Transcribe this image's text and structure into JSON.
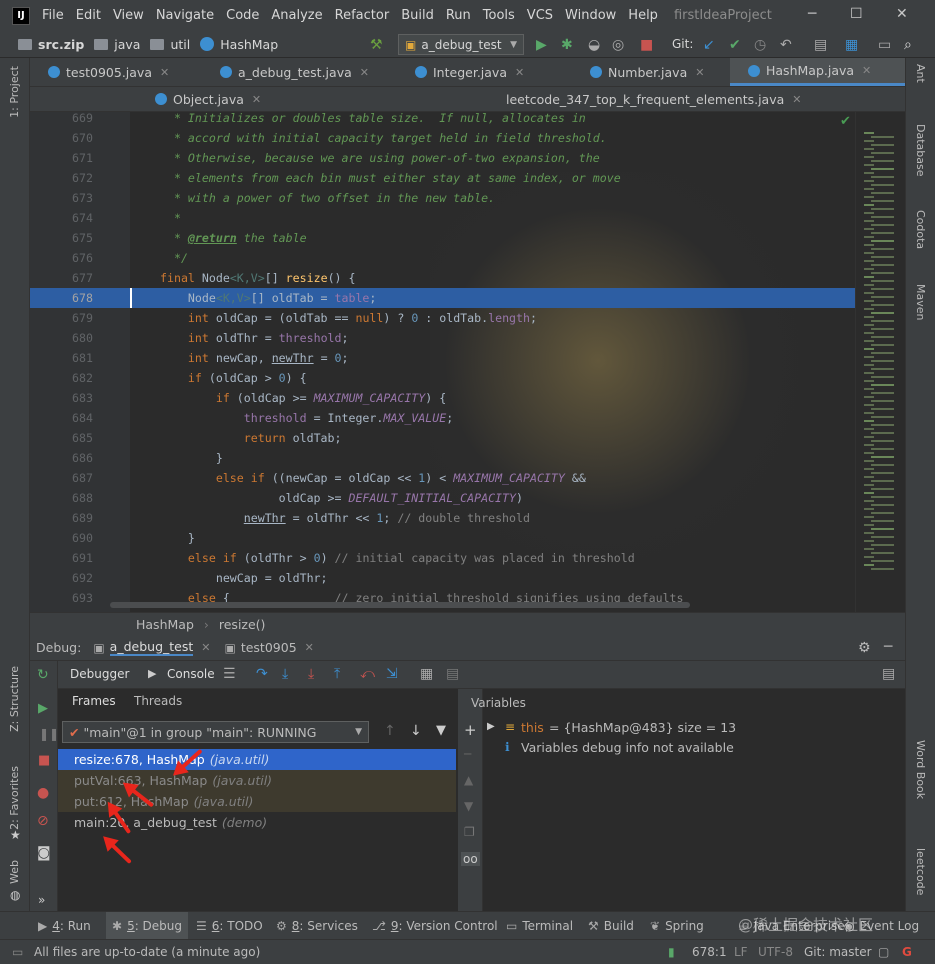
{
  "window": {
    "menu": [
      "File",
      "Edit",
      "View",
      "Navigate",
      "Code",
      "Analyze",
      "Refactor",
      "Build",
      "Run",
      "Tools",
      "VCS",
      "Window",
      "Help"
    ],
    "project_title": "firstIdeaProject"
  },
  "navbar": {
    "crumbs": [
      "src.zip",
      "java",
      "util",
      "HashMap"
    ],
    "run_config": "a_debug_test",
    "git_label": "Git:"
  },
  "editor_tabs_row1": [
    "test0905.java",
    "a_debug_test.java",
    "Integer.java",
    "Number.java",
    "HashMap.java"
  ],
  "editor_tabs_row2": [
    "Object.java",
    "leetcode_347_top_k_frequent_elements.java"
  ],
  "active_tab": "HashMap.java",
  "left_tool_windows": [
    "1: Project",
    "Z: Structure",
    "2: Favorites",
    "Web"
  ],
  "right_tool_windows": [
    "Ant",
    "Database",
    "Codota",
    "Maven",
    "Word Book",
    "leetcode"
  ],
  "code_lines": [
    {
      "n": "669",
      "html": "<span class='doc'>  * Initializes or doubles table size.  If null, allocates in</span>"
    },
    {
      "n": "670",
      "html": "<span class='doc'>  * accord with initial capacity target held in field threshold.</span>"
    },
    {
      "n": "671",
      "html": "<span class='doc'>  * Otherwise, because we are using power-of-two expansion, the</span>"
    },
    {
      "n": "672",
      "html": "<span class='doc'>  * elements from each bin must either stay at same index, or move</span>"
    },
    {
      "n": "673",
      "html": "<span class='doc'>  * with a power of two offset in the new table.</span>"
    },
    {
      "n": "674",
      "html": "<span class='doc'>  *</span>"
    },
    {
      "n": "675",
      "html": "<span class='doc'>  * </span><span class='doctag'>@return</span><span class='doc'> the table</span>"
    },
    {
      "n": "676",
      "html": "<span class='doc'>  */</span>"
    },
    {
      "n": "677",
      "html": "<span class='kw'>final</span> Node<span class='gen'>&lt;K,V&gt;</span>[] <span class='fn'>resize</span>() {"
    },
    {
      "n": "678",
      "html": "    Node<span class='gen'>&lt;K,V&gt;</span>[] oldTab = <span class='fld'>table</span>;"
    },
    {
      "n": "679",
      "html": "    <span class='kw'>int</span> oldCap = (oldTab == <span class='kw'>null</span>) ? <span class='num'>0</span> : oldTab.<span class='fld'>length</span>;"
    },
    {
      "n": "680",
      "html": "    <span class='kw'>int</span> oldThr = <span class='fld'>threshold</span>;"
    },
    {
      "n": "681",
      "html": "    <span class='kw'>int</span> newCap, <span class='und'>newThr</span> = <span class='num'>0</span>;"
    },
    {
      "n": "682",
      "html": "    <span class='kw'>if</span> (oldCap &gt; <span class='num'>0</span>) {"
    },
    {
      "n": "683",
      "html": "        <span class='kw'>if</span> (oldCap &gt;= <span class='cst'>MAXIMUM_CAPACITY</span>) {"
    },
    {
      "n": "684",
      "html": "            <span class='fld'>threshold</span> = Integer.<span class='cst'>MAX_VALUE</span>;"
    },
    {
      "n": "685",
      "html": "            <span class='kw'>return</span> oldTab;"
    },
    {
      "n": "686",
      "html": "        }"
    },
    {
      "n": "687",
      "html": "        <span class='kw'>else if</span> ((newCap = oldCap &lt;&lt; <span class='num'>1</span>) &lt; <span class='cst'>MAXIMUM_CAPACITY</span> &amp;&amp;"
    },
    {
      "n": "688",
      "html": "                 oldCap &gt;= <span class='cst'>DEFAULT_INITIAL_CAPACITY</span>)"
    },
    {
      "n": "689",
      "html": "            <span class='und'>newThr</span> = oldThr &lt;&lt; <span class='num'>1</span>; <span class='cmt'>// double threshold</span>"
    },
    {
      "n": "690",
      "html": "    }"
    },
    {
      "n": "691",
      "html": "    <span class='kw'>else if</span> (oldThr &gt; <span class='num'>0</span>) <span class='cmt'>// initial capacity was placed in threshold</span>"
    },
    {
      "n": "692",
      "html": "        newCap = oldThr;"
    },
    {
      "n": "693",
      "html": "    <span class='kw'>else</span> {               <span class='cmt'>// zero initial threshold signifies using defaults</span>"
    }
  ],
  "current_line": "678",
  "breadcrumb": [
    "HashMap",
    "resize()"
  ],
  "debug": {
    "label": "Debug:",
    "sessions": [
      "a_debug_test",
      "test0905"
    ],
    "subtabs": [
      "Debugger",
      "Console"
    ],
    "panels": [
      "Frames",
      "Threads"
    ],
    "thread": "\"main\"@1 in group \"main\": RUNNING",
    "frames": [
      {
        "method": "resize:678, HashMap",
        "pkg": "(java.util)",
        "kind": "sel"
      },
      {
        "method": "putVal:663, HashMap",
        "pkg": "(java.util)",
        "kind": "lib"
      },
      {
        "method": "put:612, HashMap",
        "pkg": "(java.util)",
        "kind": "lib"
      },
      {
        "method": "main:20, a_debug_test",
        "pkg": "(demo)",
        "kind": "normal"
      }
    ],
    "variables_title": "Variables",
    "var_this_name": "this",
    "var_this_value": "= {HashMap@483}  size = 13",
    "var_info": "Variables debug info not available"
  },
  "bottom_tools": [
    {
      "num": "4",
      "label": ": Run"
    },
    {
      "num": "5",
      "label": ": Debug"
    },
    {
      "num": "6",
      "label": ": TODO"
    },
    {
      "num": "8",
      "label": ": Services"
    },
    {
      "num": "9",
      "label": ": Version Control"
    },
    {
      "num": "",
      "label": "Terminal"
    },
    {
      "num": "",
      "label": "Build"
    },
    {
      "num": "",
      "label": "Spring"
    },
    {
      "num": "",
      "label": "Java Enterprise"
    },
    {
      "num": "",
      "label": "Event Log"
    }
  ],
  "status": {
    "message": "All files are up-to-date (a minute ago)",
    "position": "678:1",
    "line_sep": "LF",
    "encoding": "UTF-8",
    "git_branch": "Git: master"
  },
  "watermark": "@稀土掘金技术社区",
  "colors": {
    "accent": "#2f65ca",
    "current_line": "#2d5ea3",
    "annotation_arrow": "#e8261c"
  }
}
